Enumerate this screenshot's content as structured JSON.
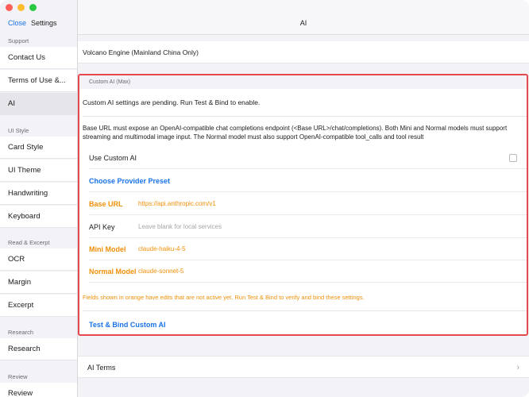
{
  "sidebar": {
    "close_label": "Close",
    "title": "Settings",
    "sections": [
      {
        "label": "Support",
        "items": [
          "Contact Us",
          "Terms of Use &..."
        ]
      },
      {
        "label": "",
        "items": [
          "AI"
        ]
      },
      {
        "label": "UI Style",
        "items": [
          "Card Style",
          "UI Theme",
          "Handwriting",
          "Keyboard"
        ]
      },
      {
        "label": "Read & Excerpt",
        "items": [
          "OCR",
          "Margin",
          "Excerpt"
        ]
      },
      {
        "label": "Research",
        "items": [
          "Research"
        ]
      },
      {
        "label": "Review",
        "items": [
          "Review"
        ]
      }
    ],
    "selected": "AI"
  },
  "main": {
    "title": "AI",
    "volcano_label": "Volcano Engine (Mainland China Only)",
    "custom": {
      "header": "Custom AI (Max)",
      "pending": "Custom AI settings are pending. Run Test & Bind to enable.",
      "description": "Base URL must expose an OpenAI-compatible chat completions endpoint (<Base URL>/chat/completions). Both Mini and Normal models must support streaming and multimodal image input. The Normal model must also support OpenAI-compatible tool_calls and tool result",
      "use_custom_label": "Use Custom AI",
      "use_custom_checked": false,
      "preset_label": "Choose Provider Preset",
      "base_url_label": "Base URL",
      "base_url_value": "https://api.anthropic.com/v1",
      "api_key_label": "API Key",
      "api_key_placeholder": "Leave blank for local services",
      "mini_label": "Mini Model",
      "mini_value": "claude-haiku-4-5",
      "normal_label": "Normal Model",
      "normal_value": "claude-sonnet-5",
      "note": "Fields shown in orange have edits that are not active yet. Run Test & Bind to verify and bind these settings.",
      "test_bind_label": "Test & Bind Custom AI"
    },
    "terms_label": "AI Terms"
  },
  "colors": {
    "accent": "#1a73e8",
    "pending_orange": "#f0900a",
    "highlight_border": "#e5484d"
  }
}
